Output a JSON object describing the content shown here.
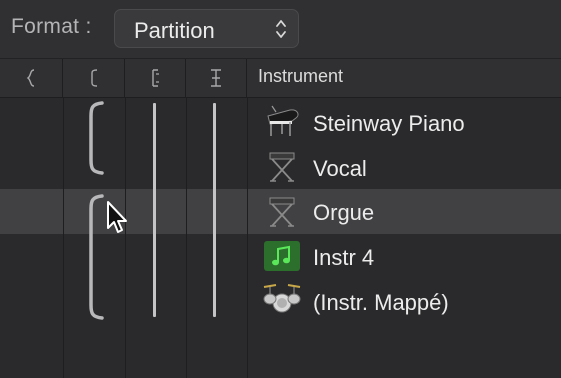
{
  "toolbar": {
    "format_label": "Format :",
    "format_value": "Partition"
  },
  "columns": {
    "instrument_header": "Instrument",
    "bracket_icons": [
      "curly-brace-icon",
      "square-bracket-icon",
      "bracket-line-icon",
      "bar-line-icon"
    ]
  },
  "instruments": [
    {
      "name": "Steinway Piano",
      "icon": "grand-piano-icon",
      "selected": false
    },
    {
      "name": "Vocal",
      "icon": "keyboard-stand-icon",
      "selected": false
    },
    {
      "name": "Orgue",
      "icon": "keyboard-stand-icon",
      "selected": true
    },
    {
      "name": "Instr 4",
      "icon": "music-note-icon",
      "selected": false
    },
    {
      "name": "(Instr. Mappé)",
      "icon": "drum-kit-icon",
      "selected": false
    }
  ],
  "colors": {
    "background": "#2a2a2c",
    "selected_row": "#414143",
    "note_icon_bg": "#2f7a2f",
    "note_icon_fg": "#4fe04f"
  }
}
